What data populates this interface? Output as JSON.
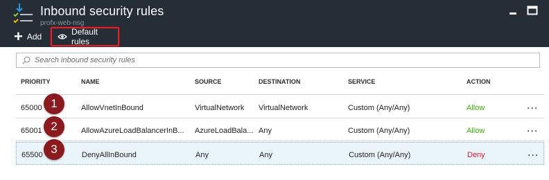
{
  "header": {
    "title": "Inbound security rules",
    "subtitle": "profx-web-nsg"
  },
  "toolbar": {
    "add_label": "Add",
    "default_rules_label": "Default rules"
  },
  "search": {
    "placeholder": "Search inbound security rules"
  },
  "columns": [
    "PRIORITY",
    "NAME",
    "SOURCE",
    "DESTINATION",
    "SERVICE",
    "ACTION"
  ],
  "rules": [
    {
      "priority": "65000",
      "name": "AllowVnetInBound",
      "source": "VirtualNetwork",
      "destination": "VirtualNetwork",
      "service": "Custom (Any/Any)",
      "action": "Allow",
      "more": "...",
      "callout": "1"
    },
    {
      "priority": "65001",
      "name": "AllowAzureLoadBalancerInB...",
      "source": "AzureLoadBala...",
      "destination": "Any",
      "service": "Custom (Any/Any)",
      "action": "Allow",
      "more": "...",
      "callout": "2"
    },
    {
      "priority": "65500",
      "name": "DenyAllInBound",
      "source": "Any",
      "destination": "Any",
      "service": "Custom (Any/Any)",
      "action": "Deny",
      "more": "...",
      "callout": "3"
    }
  ],
  "colors": {
    "header_bg": "#252d36",
    "allow": "#3bb000",
    "deny": "#e8112d",
    "callout": "#8b1a1f",
    "highlight_border": "#d9252c",
    "selected_row": "#e9f5fb"
  }
}
